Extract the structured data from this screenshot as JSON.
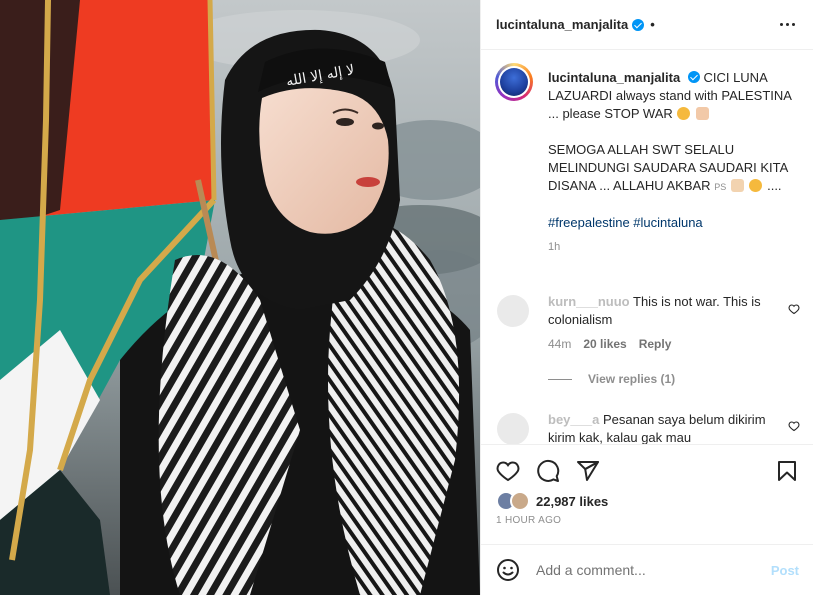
{
  "post": {
    "username": "lucintaluna_manjalita",
    "dot": "•"
  },
  "caption": {
    "username": "lucintaluna_manjalita",
    "line1": "CICI LUNA LAZUARDI always stand with PALESTINA ... please STOP WAR",
    "line2": "SEMOGA ALLAH SWT SELALU MELINDUNGI SAUDARA SAUDARI KITA DISANA ... ALLAHU AKBAR",
    "ps": "PS",
    "line2_tail": "....",
    "hashtags": "#freepalestine #lucintaluna",
    "time": "1h"
  },
  "comments": [
    {
      "user": "kurn___nuuo",
      "text": "This is not war. This is colonialism",
      "time": "44m",
      "likes": "20 likes",
      "reply": "Reply",
      "view_replies": "View replies (1)"
    },
    {
      "user": "bey___a",
      "text": "Pesanan saya belum dikirim kirim kak, kalau gak mau"
    }
  ],
  "actions": {
    "likes": "22,987 likes",
    "time": "1 HOUR AGO"
  },
  "add_comment": {
    "placeholder": "Add a comment...",
    "post_label": "Post"
  },
  "media": {
    "headband_text": "لا إله إلا الله"
  },
  "colors": {
    "accent": "#0095f6",
    "link": "#00376b",
    "post_disabled": "#b2dffc",
    "flag_red": "#e8321f",
    "flag_green": "#1e9a8a"
  }
}
